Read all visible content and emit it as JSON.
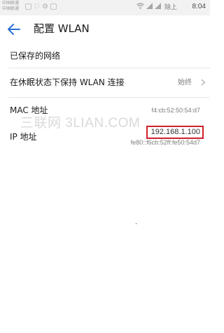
{
  "status_bar": {
    "carriers": [
      "中国联通",
      "中国联通"
    ],
    "alarm_text": "⏰",
    "carrier_suffix": "除上",
    "time": "8:04"
  },
  "header": {
    "back_icon": "back-arrow-icon",
    "title": "配置 WLAN"
  },
  "rows": {
    "saved_networks": {
      "label": "已保存的网络"
    },
    "sleep_keep": {
      "label": "在休眠状态下保持 WLAN 连接",
      "value": "始终"
    },
    "mac": {
      "label": "MAC 地址",
      "value": "f4:cb:52:50:54:d7"
    },
    "ip": {
      "label": "IP 地址",
      "ipv4": "192.168.1.100",
      "ipv6": "fe80::f6cb:52ff:fe50:54d7"
    }
  },
  "watermark": "三联网 3LIAN.COM",
  "colors": {
    "accent": "#2b6fd6",
    "highlight": "#d0202c",
    "status_bg": "#f2f2f2"
  }
}
